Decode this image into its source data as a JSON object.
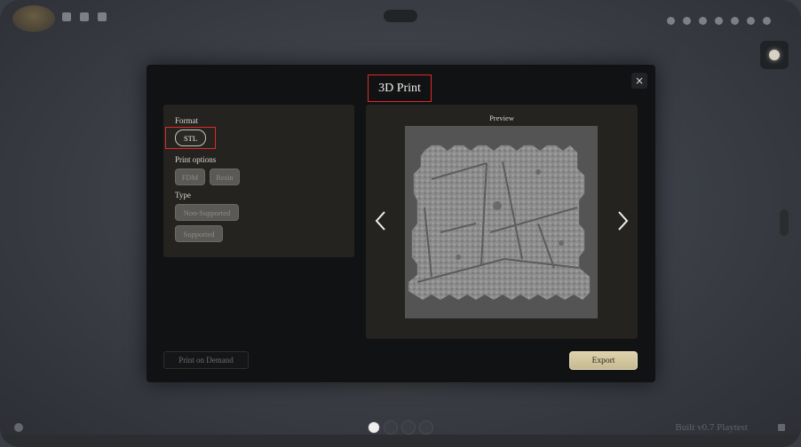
{
  "dialog": {
    "title": "3D Print",
    "close_icon": "×"
  },
  "options": {
    "format_label": "Format",
    "format_value": "STL",
    "print_options_label": "Print options",
    "print_options": [
      "FDM",
      "Resin"
    ],
    "type_label": "Type",
    "types": [
      "Non-Supported",
      "Supported"
    ]
  },
  "preview": {
    "label": "Preview"
  },
  "footer": {
    "print_on_demand": "Print on Demand",
    "export": "Export"
  },
  "app": {
    "version_text": "Built v0.7 Playtest"
  },
  "colors": {
    "highlight": "#e02a2a",
    "export_button": "#d5c9a2",
    "modal_bg": "#111214",
    "panel_bg": "#24231f"
  }
}
